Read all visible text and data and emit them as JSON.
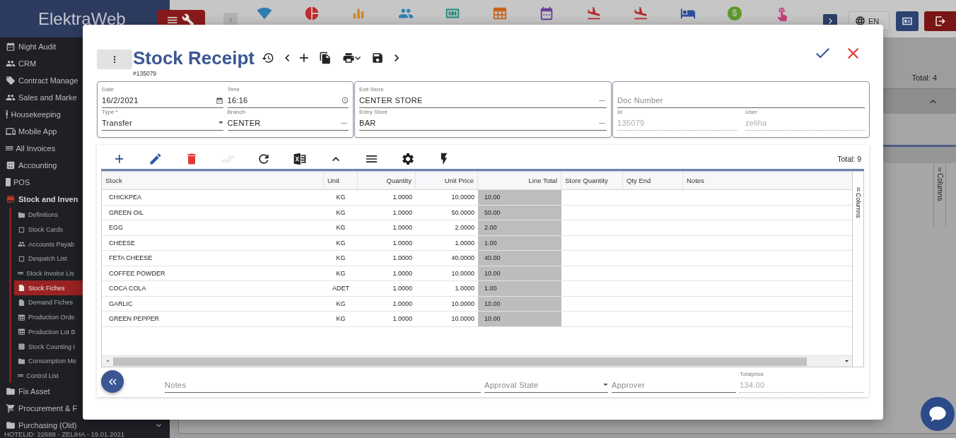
{
  "app": {
    "logo": "ElektraWeb",
    "language": "EN",
    "footer": "HOTELID: 22688 - ZELIHA - 19.01.2021"
  },
  "sidebar": {
    "items": [
      {
        "kind": "calendar",
        "label": "Night Audit",
        "expanded": false
      },
      {
        "kind": "people",
        "label": "CRM",
        "expanded": false
      },
      {
        "kind": "tag",
        "label": "Contract Manage",
        "expanded": false
      },
      {
        "kind": "people",
        "label": "Sales and Marke",
        "expanded": false
      },
      {
        "kind": "person",
        "label": "Housekeeping",
        "expanded": false
      },
      {
        "kind": "devices",
        "label": "Mobile App",
        "expanded": false
      },
      {
        "kind": "list",
        "label": "All Invoices",
        "expanded": false
      },
      {
        "kind": "calc",
        "label": "Accounting",
        "expanded": false
      },
      {
        "kind": "pos",
        "label": "POS",
        "expanded": false
      },
      {
        "kind": "store",
        "label": "Stock and Inven",
        "expanded": true,
        "children": [
          {
            "kind": "folder",
            "label": "Definitions",
            "selected": false
          },
          {
            "kind": "square",
            "label": "Stock Cards",
            "selected": false
          },
          {
            "kind": "people",
            "label": "Accounts Payab",
            "selected": false
          },
          {
            "kind": "square",
            "label": "Despatch List",
            "selected": false
          },
          {
            "kind": "list",
            "label": "Stock Invoice Lis",
            "selected": false
          },
          {
            "kind": "doc",
            "label": "Stock Fiches",
            "selected": true
          },
          {
            "kind": "doc",
            "label": "Demand Fiches",
            "selected": false
          },
          {
            "kind": "grid",
            "label": "Production Orde",
            "selected": false
          },
          {
            "kind": "grid",
            "label": "Production Lot B",
            "selected": false
          },
          {
            "kind": "calc",
            "label": "Stock Counting I",
            "selected": false
          },
          {
            "kind": "folder",
            "label": "Consumption Me",
            "selected": false
          },
          {
            "kind": "list",
            "label": "Control List",
            "selected": false
          }
        ]
      },
      {
        "kind": "folder",
        "label": "Fix Asset",
        "expanded": false
      },
      {
        "kind": "cart",
        "label": "Procurement & F",
        "expanded": false
      },
      {
        "kind": "folder",
        "label": "Purchasing (Old)",
        "expanded": false
      }
    ]
  },
  "topbar": {
    "icons": [
      {
        "kind": "wifi"
      },
      {
        "kind": "pie"
      },
      {
        "kind": "bars"
      },
      {
        "kind": "people"
      },
      {
        "kind": "counter"
      },
      {
        "kind": "grid"
      },
      {
        "kind": "calendar"
      },
      {
        "kind": "landing"
      },
      {
        "kind": "landing"
      },
      {
        "kind": "bed"
      },
      {
        "kind": "dollar"
      },
      {
        "kind": "hand"
      }
    ]
  },
  "background_panel": {
    "total": "Total: 4",
    "columns_tab": "Columns"
  },
  "dialog": {
    "title": "Stock Receipt",
    "number": "#135079",
    "cards": [
      {
        "fields": [
          {
            "kind": "date",
            "label": "Date",
            "value": "16/2/2021",
            "disabled": false
          },
          {
            "kind": "time",
            "label": "Time",
            "value": "16:16",
            "disabled": false
          },
          {
            "kind": "select",
            "label": "Type *",
            "value": "Transfer",
            "disabled": false
          },
          {
            "kind": "lookup",
            "label": "Branch",
            "value": "CENTER",
            "suffix": "---",
            "disabled": false
          }
        ]
      },
      {
        "fields": [
          {
            "kind": "lookup",
            "label": "Exit Store",
            "value": "CENTER STORE",
            "suffix": "---",
            "disabled": false
          },
          {
            "kind": "lookup",
            "label": "Entry Store",
            "value": "BAR",
            "suffix": "---",
            "disabled": false
          }
        ]
      },
      {
        "fields": [
          {
            "kind": "text",
            "placeholder": "Doc Number",
            "disabled": false
          },
          {
            "kind": "text",
            "label": "Id",
            "value": "135079",
            "disabled": true
          },
          {
            "kind": "text",
            "label": "User",
            "value": "zeliha",
            "disabled": true
          }
        ]
      }
    ],
    "grid": {
      "toolbar": [
        {
          "kind": "add",
          "disabled": false
        },
        {
          "kind": "edit",
          "disabled": false
        },
        {
          "kind": "delete",
          "disabled": false
        },
        {
          "kind": "approve",
          "disabled": true
        },
        {
          "kind": "refresh",
          "disabled": false
        },
        {
          "kind": "excel",
          "disabled": false
        },
        {
          "kind": "collapse",
          "disabled": false
        },
        {
          "kind": "menu",
          "disabled": false
        },
        {
          "kind": "settings",
          "disabled": false
        },
        {
          "kind": "bolt",
          "disabled": false
        }
      ],
      "total": "Total: 9",
      "columns": [
        "Stock",
        "Unit",
        "Quantity",
        "Unit Price",
        "Line Total",
        "Store Quantity",
        "Qty End",
        "Notes"
      ],
      "rows": [
        {
          "cells": [
            "CHICKPEA",
            "KG",
            "1.0000",
            "10.0000",
            "10.00"
          ]
        },
        {
          "cells": [
            "GREEN OIL",
            "KG",
            "1.0000",
            "50.0000",
            "50.00"
          ]
        },
        {
          "cells": [
            "EGG",
            "KG",
            "1.0000",
            "2.0000",
            "2.00"
          ]
        },
        {
          "cells": [
            "CHEESE",
            "KG",
            "1.0000",
            "1.0000",
            "1.00"
          ]
        },
        {
          "cells": [
            "FETA CHEESE",
            "KG",
            "1.0000",
            "40.0000",
            "40.00"
          ]
        },
        {
          "cells": [
            "COFFEE POWDER",
            "KG",
            "1.0000",
            "10.0000",
            "10.00"
          ]
        },
        {
          "cells": [
            "COCA COLA",
            "ADET",
            "1.0000",
            "1.0000",
            "1.00"
          ]
        },
        {
          "cells": [
            "GARLIC",
            "KG",
            "1.0000",
            "10.0000",
            "10.00"
          ]
        },
        {
          "cells": [
            "GREEN PEPPER",
            "KG",
            "1.0000",
            "10.0000",
            "10.00"
          ]
        }
      ],
      "columns_tab": "Columns"
    },
    "footer": {
      "fields": [
        {
          "kind": "text",
          "placeholder": "Notes",
          "disabled": false
        },
        {
          "kind": "select",
          "placeholder": "Approval State",
          "disabled": false
        },
        {
          "kind": "text",
          "placeholder": "Approver",
          "disabled": false
        },
        {
          "kind": "text",
          "label": "Totalprice",
          "value": "134.00",
          "disabled": true
        }
      ]
    }
  }
}
